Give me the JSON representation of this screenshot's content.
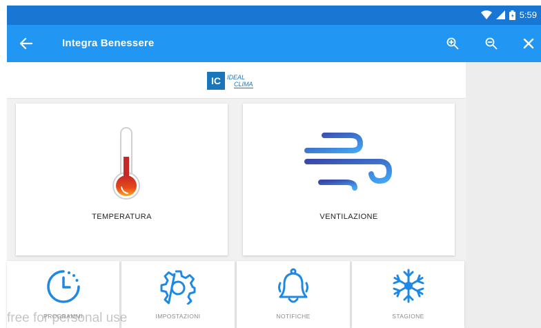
{
  "status_bar": {
    "time": "5:59",
    "icons": [
      "wifi-icon",
      "signal-icon",
      "battery-icon"
    ]
  },
  "app_bar": {
    "title": "Integra Benessere",
    "actions": [
      "back-arrow-icon",
      "zoom-in-icon",
      "zoom-out-icon",
      "close-icon"
    ]
  },
  "logo": {
    "mark": "IC",
    "line1": "IDEAL",
    "line2": "CLIMA"
  },
  "tiles": {
    "temperature": "TEMPERATURA",
    "ventilation": "VENTILAZIONE",
    "programs": "PROGRAMMI",
    "settings": "IMPOSTAZIONI",
    "notifications": "NOTIFICHE",
    "season": "STAGIONE"
  },
  "watermark": "free for personal use",
  "colors": {
    "status_bar": "#1976d2",
    "app_bar": "#2196f3",
    "icon_blue": "#1e88e5",
    "brand": "#1b75bb"
  }
}
